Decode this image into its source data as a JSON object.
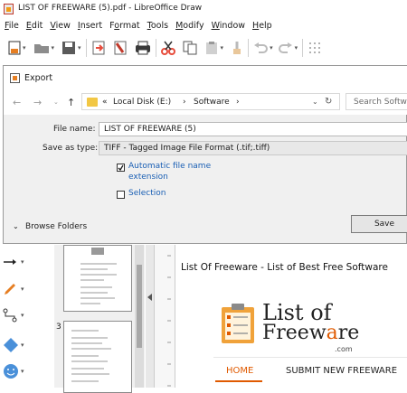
{
  "window": {
    "title": "LIST OF FREEWARE (5).pdf - LibreOffice Draw"
  },
  "menu": [
    "File",
    "Edit",
    "View",
    "Insert",
    "Format",
    "Tools",
    "Modify",
    "Window",
    "Help"
  ],
  "menu_underline": [
    "F",
    "E",
    "V",
    "I",
    "o",
    "T",
    "M",
    "W",
    "H"
  ],
  "dialog": {
    "title": "Export",
    "path": {
      "prefix": "«",
      "drive": "Local Disk (E:)",
      "sep": "›",
      "folder": "Software",
      "sep2": "›"
    },
    "search_placeholder": "Search Software",
    "file_name_label": "File name:",
    "file_name_value": "LIST OF FREEWARE (5)",
    "save_type_label": "Save as type:",
    "save_type_value": "TIFF - Tagged Image File Format (.tif;.tiff)",
    "auto_ext_line1": "Automatic file name",
    "auto_ext_line2": "extension",
    "auto_ext_checked": true,
    "selection_label": "Selection",
    "selection_checked": false,
    "browse_folders": "Browse Folders",
    "save_button": "Save"
  },
  "pages": {
    "page3_label": "3"
  },
  "document": {
    "heading": "List Of Freeware - List of Best Free Software",
    "logo_line1": "List of",
    "logo_line2_a": "Freew",
    "logo_line2_b": "a",
    "logo_line2_c": "re",
    "logo_line3": ".com",
    "nav_home": "HOME",
    "nav_submit": "SUBMIT NEW FREEWARE"
  },
  "colors": {
    "accent": "#e05a00",
    "link": "#1a5fb4"
  }
}
